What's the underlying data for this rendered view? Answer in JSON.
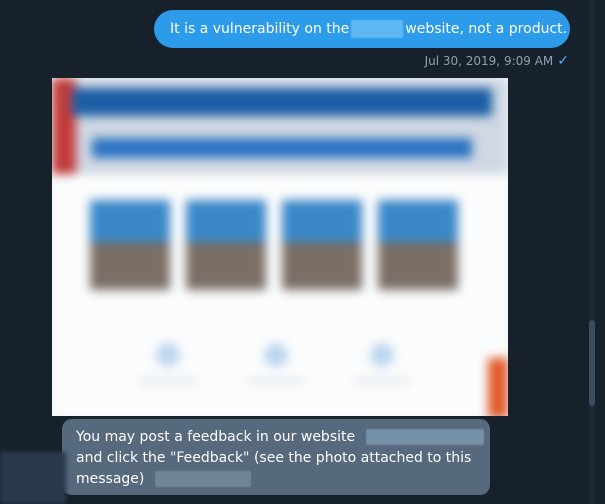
{
  "messages": {
    "outgoing": {
      "text_before": "It is a vulnerability on the",
      "text_after": "website, not a product.",
      "timestamp": "Jul 30, 2019, 9:09 AM",
      "status_icon": "single-check-icon"
    },
    "incoming": {
      "line1": "You may post a feedback in our website",
      "line2": "and click the \"Feedback\" (see the photo attached to this",
      "line3": "message)"
    }
  },
  "colors": {
    "background": "#17212b",
    "outgoing_bubble": "#2b9bea",
    "incoming_bubble": "#56697d",
    "timestamp_text": "#8da0b2",
    "check": "#4fb4ff"
  }
}
